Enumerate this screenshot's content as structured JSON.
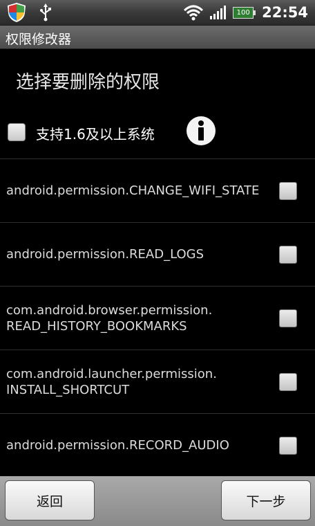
{
  "status_bar": {
    "icons": [
      "shield-icon",
      "usb-icon",
      "wifi-icon",
      "signal-icon",
      "battery-icon"
    ],
    "battery_level": "100",
    "time": "22:54"
  },
  "title_bar": {
    "title": "权限修改器"
  },
  "main": {
    "heading": "选择要删除的权限",
    "support_option": {
      "label": "支持1.6及以上系统",
      "checked": false
    },
    "permissions": [
      {
        "name": "android.permission.CHANGE_WIFI_STATE",
        "checked": false
      },
      {
        "name": "android.permission.READ_LOGS",
        "checked": false
      },
      {
        "name": "com.android.browser.permission.\nREAD_HISTORY_BOOKMARKS",
        "checked": false
      },
      {
        "name": "com.android.launcher.permission.\nINSTALL_SHORTCUT",
        "checked": false
      },
      {
        "name": "android.permission.RECORD_AUDIO",
        "checked": false
      }
    ]
  },
  "buttons": {
    "back": "返回",
    "next": "下一步"
  },
  "colors": {
    "background": "#000000",
    "checkbox": "#d9d9d9",
    "shield_red": "#d32f2f",
    "shield_green": "#43a047",
    "shield_blue": "#1e88e5",
    "shield_yellow": "#fbc02d"
  }
}
